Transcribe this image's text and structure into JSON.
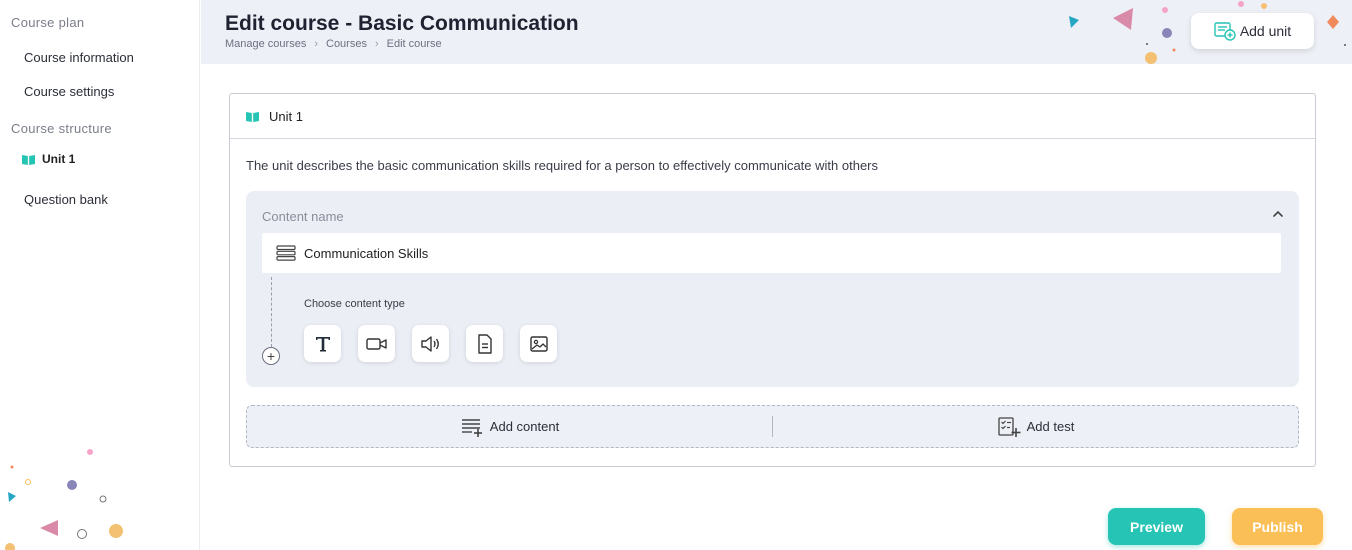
{
  "sidebar": {
    "section_plan": "Course plan",
    "course_information": "Course information",
    "course_settings": "Course settings",
    "section_structure": "Course structure",
    "unit": "Unit 1",
    "question_bank": "Question bank"
  },
  "header": {
    "title": "Edit course - Basic Communication",
    "breadcrumb": [
      "Manage courses",
      "Courses",
      "Edit course"
    ],
    "breadcrumb_sep": "›",
    "add_unit_label": "Add unit"
  },
  "unit": {
    "title": "Unit 1",
    "description": "The unit describes the basic communication skills required for a person to effectively communicate with others",
    "content_label": "Content name",
    "content_name": "Communication Skills",
    "choose_type_label": "Choose content type",
    "plus": "+",
    "content_types": [
      "text-icon",
      "video-icon",
      "audio-icon",
      "document-icon",
      "image-icon"
    ]
  },
  "actions": {
    "add_content": "Add content",
    "add_test": "Add test",
    "preview": "Preview",
    "publish": "Publish"
  },
  "colors": {
    "accent_teal": "#25c4b4",
    "accent_orange": "#fbbf57",
    "header_bg": "#eef0f7"
  }
}
